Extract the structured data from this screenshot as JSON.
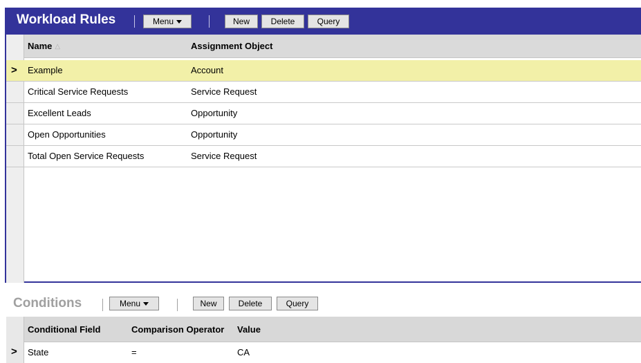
{
  "workload": {
    "title": "Workload Rules",
    "menu_label": "Menu",
    "buttons": {
      "new": "New",
      "delete": "Delete",
      "query": "Query"
    },
    "columns": {
      "name": "Name",
      "assignment_object": "Assignment Object"
    },
    "sort_indicator": "ascending",
    "rows": [
      {
        "name": "Example",
        "object": "Account",
        "selected": true
      },
      {
        "name": "Critical Service Requests",
        "object": "Service Request",
        "selected": false
      },
      {
        "name": "Excellent Leads",
        "object": "Opportunity",
        "selected": false
      },
      {
        "name": "Open Opportunities",
        "object": "Opportunity",
        "selected": false
      },
      {
        "name": "Total Open Service Requests",
        "object": "Service Request",
        "selected": false
      }
    ]
  },
  "conditions": {
    "title": "Conditions",
    "menu_label": "Menu",
    "buttons": {
      "new": "New",
      "delete": "Delete",
      "query": "Query"
    },
    "columns": {
      "field": "Conditional Field",
      "operator": "Comparison Operator",
      "value": "Value"
    },
    "rows": [
      {
        "field": "State",
        "operator": "=",
        "value": "CA",
        "selected": true
      }
    ]
  },
  "colors": {
    "header_bar": "#33339a",
    "selected_row": "#f2f0a8",
    "grid_header": "#dadada"
  }
}
